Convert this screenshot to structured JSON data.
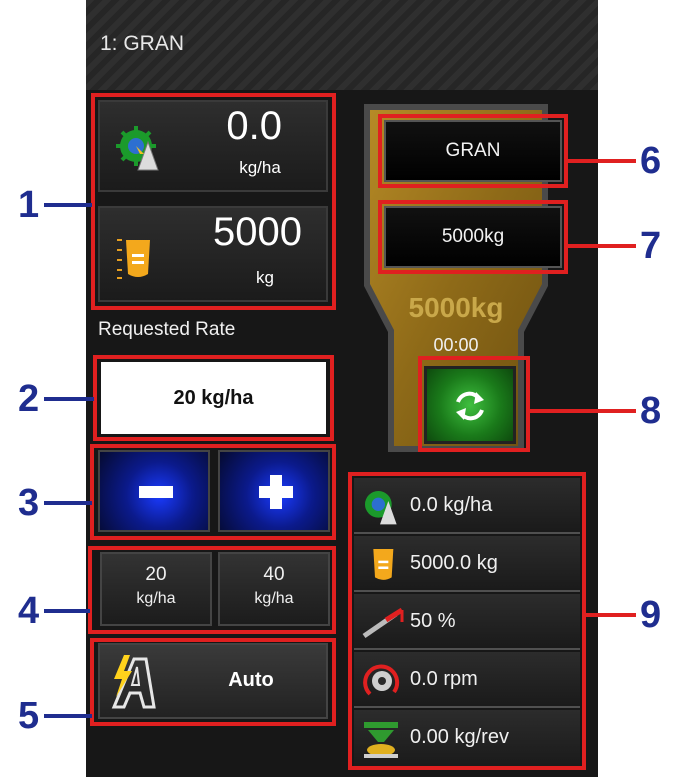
{
  "title": "1: GRAN",
  "callouts": {
    "c1": "1",
    "c2": "2",
    "c3": "3",
    "c4": "4",
    "c5": "5",
    "c6": "6",
    "c7": "7",
    "c8": "8",
    "c9": "9"
  },
  "applied": {
    "value": "0.0",
    "unit": "kg/ha",
    "icon": "applied-rate-icon"
  },
  "bin": {
    "value": "5000",
    "unit": "kg",
    "icon": "bin-level-icon"
  },
  "requested": {
    "label": "Requested Rate",
    "value": "20 kg/ha"
  },
  "step": {
    "minus": "−",
    "plus": "+"
  },
  "presets": [
    {
      "value": "20",
      "unit": "kg/ha"
    },
    {
      "value": "40",
      "unit": "kg/ha"
    }
  ],
  "mode": {
    "label": "Auto",
    "icon": "auto-mode-icon"
  },
  "hopper": {
    "product": "GRAN",
    "amount": "5000kg",
    "overlay_amount": "5000kg",
    "time": "00:00",
    "refill_icon": "refresh-icon"
  },
  "details": [
    {
      "icon": "applied-rate-icon",
      "text": "0.0 kg/ha"
    },
    {
      "icon": "bin-level-icon",
      "text": "5000.0 kg"
    },
    {
      "icon": "gate-position-icon",
      "text": "50 %"
    },
    {
      "icon": "shaft-speed-icon",
      "text": "0.0 rpm"
    },
    {
      "icon": "calibration-icon",
      "text": "0.00 kg/rev"
    }
  ],
  "colors": {
    "callout_number": "#1f2d8f",
    "highlight": "#e02020",
    "hopper": "#a8801f",
    "accent_green": "#1f8a1f"
  }
}
